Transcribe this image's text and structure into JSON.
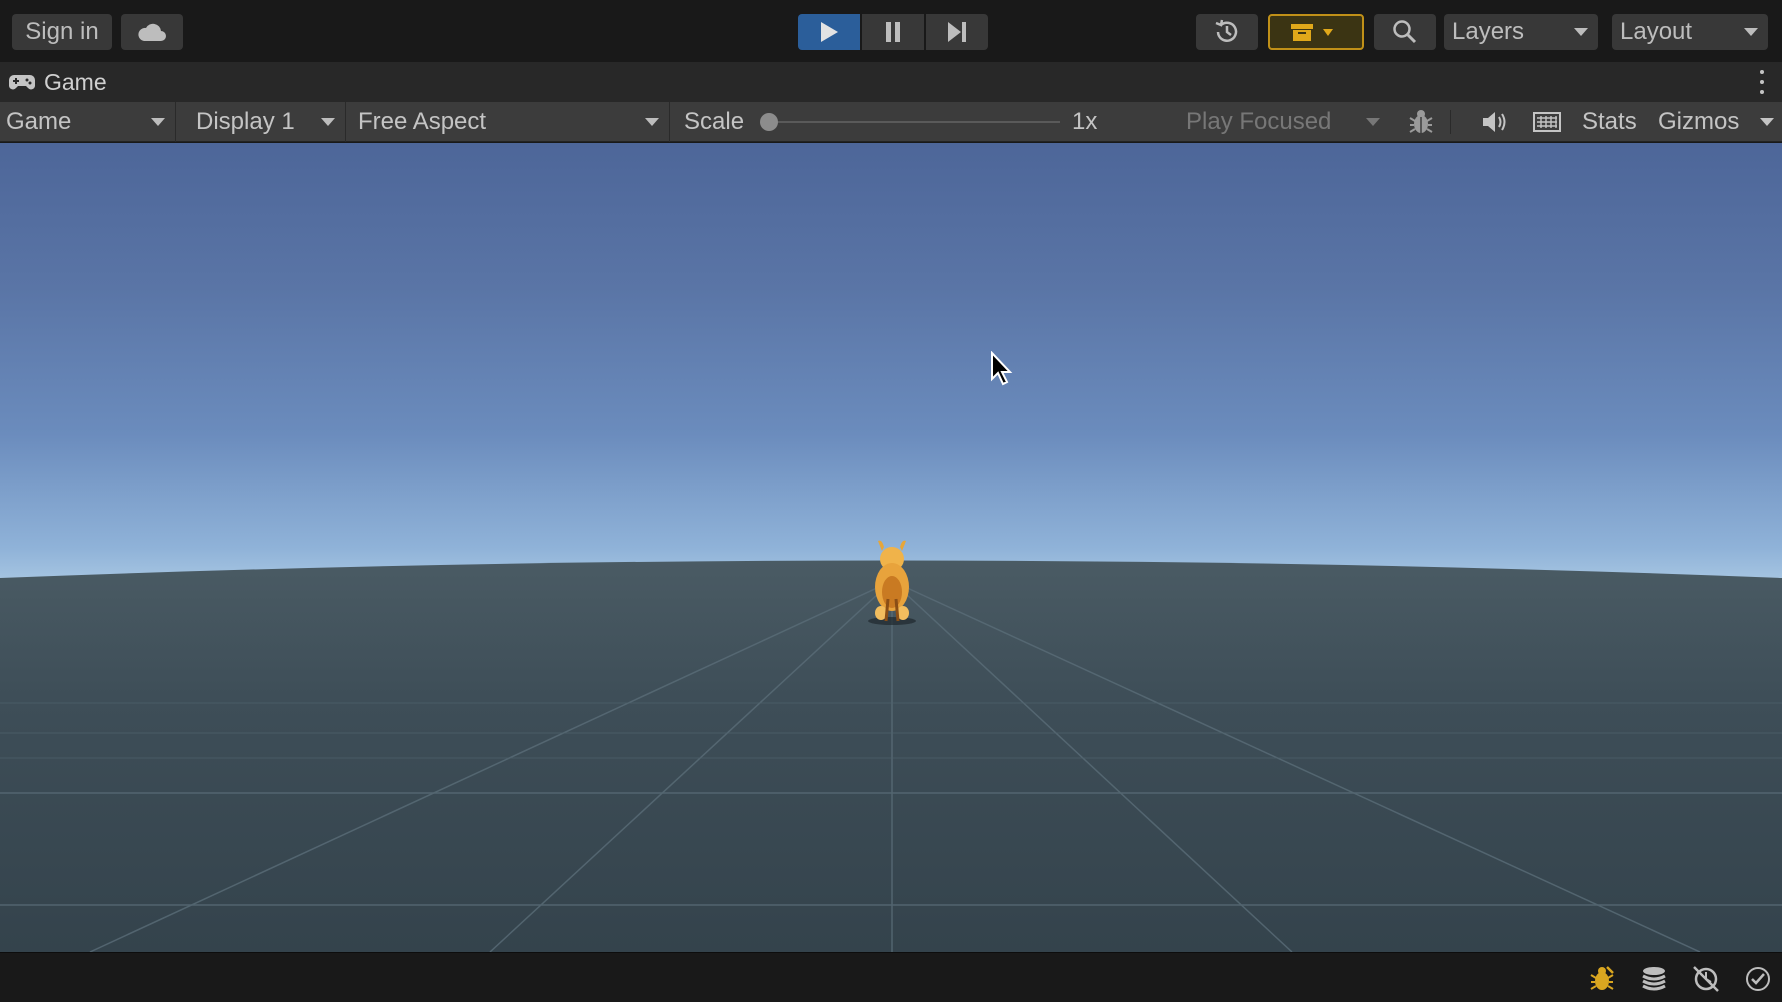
{
  "toolbar": {
    "sign_in_label": "Sign in",
    "cloud_icon": "cloud-icon",
    "play_icon": "play-icon",
    "pause_icon": "pause-icon",
    "step_icon": "step-icon",
    "history_icon": "history-icon",
    "package_icon": "package-icon",
    "search_icon": "search-icon",
    "layers_label": "Layers",
    "layout_label": "Layout",
    "play_active_color": "#2b5e9a",
    "package_accent_color": "#c09018"
  },
  "tab": {
    "title": "Game",
    "icon": "gamepad-icon"
  },
  "game_toolbar": {
    "view_select": "Game",
    "display_select": "Display 1",
    "aspect_select": "Free Aspect",
    "scale_label": "Scale",
    "scale_value": "1x",
    "play_mode_select": "Play Focused",
    "bug_icon": "bug-icon",
    "mute_icon": "speaker-icon",
    "keyboard_icon": "keyboard-icon",
    "stats_label": "Stats",
    "gizmos_label": "Gizmos"
  },
  "viewport": {
    "sky_top_color": "#4d6699",
    "horizon_color": "#e6f5f6",
    "ground_color": "#3b4b55",
    "character": "orange-fox-character"
  },
  "status_bar": {
    "icons": [
      "bug-status-icon",
      "stack-icon",
      "no-sync-icon",
      "check-circle-icon"
    ]
  }
}
